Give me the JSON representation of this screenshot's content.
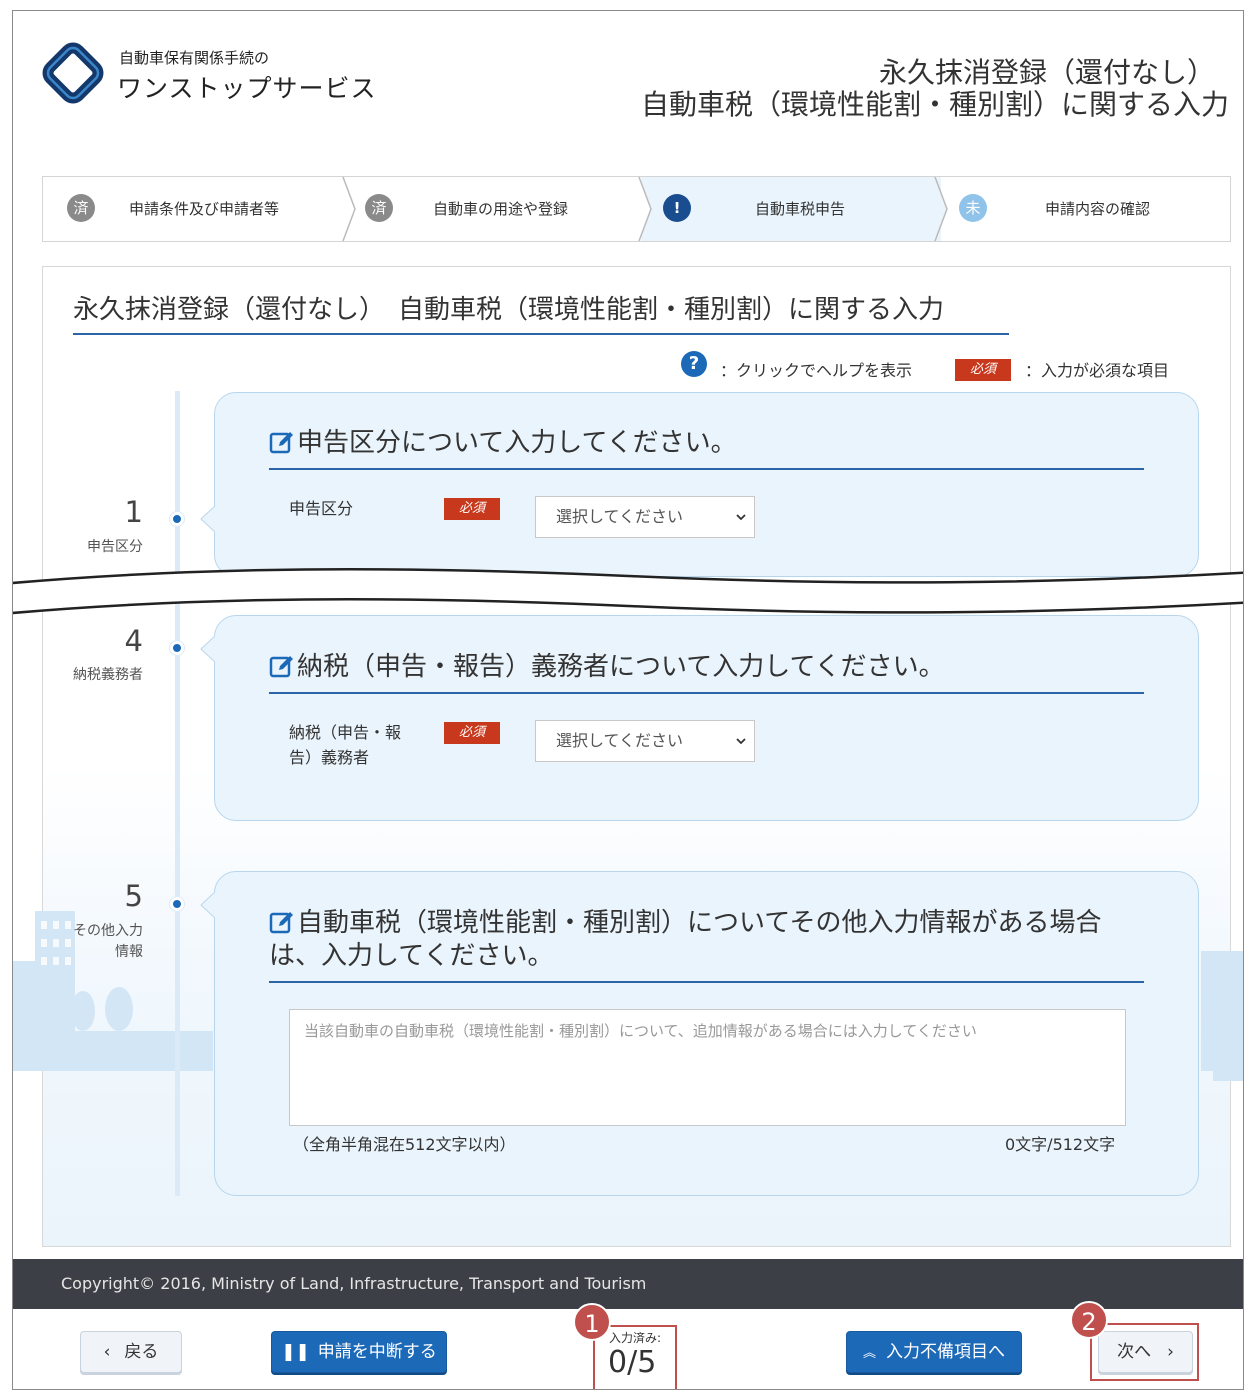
{
  "header": {
    "logo_line1": "自動車保有関係手続の",
    "logo_line2": "ワンストップサービス",
    "title_line1": "永久抹消登録（還付なし）",
    "title_line2": "自動車税（環境性能割・種別割）に関する入力"
  },
  "steps": [
    {
      "badge": "済",
      "label": "申請条件及び申請者等",
      "state": "done",
      "badge_color": "#8a8a8a"
    },
    {
      "badge": "済",
      "label": "自動車の用途や登録",
      "state": "done",
      "badge_color": "#8a8a8a"
    },
    {
      "badge": "!",
      "label": "自動車税申告",
      "state": "current",
      "badge_color": "#1a4d8f"
    },
    {
      "badge": "未",
      "label": "申請内容の確認",
      "state": "todo",
      "badge_color": "#8fc3ea"
    }
  ],
  "main": {
    "title": "永久抹消登録（還付なし）　自動車税（環境性能割・種別割）に関する入力",
    "legend_help_icon": "question-circle-icon",
    "legend_help_text": "：クリックでヘルプを表示",
    "legend_required_badge": "必須",
    "legend_required_text": "：入力が必須な項目"
  },
  "sections": [
    {
      "number": "1",
      "label": "申告区分",
      "title": "申告区分について入力してください。",
      "field_label": "申告区分",
      "required": "必須",
      "select_value": "選択してください"
    },
    {
      "number": "4",
      "label": "納税義務者",
      "title": "納税（申告・報告）義務者について入力してください。",
      "field_label": "納税（申告・報告）義務者",
      "required": "必須",
      "select_value": "選択してください"
    },
    {
      "number": "5",
      "label": "その他入力情報",
      "title": "自動車税（環境性能割・種別割）についてその他入力情報がある場合は、入力してください。",
      "textarea_placeholder": "当該自動車の自動車税（環境性能割・種別割）について、追加情報がある場合には入力してください",
      "textarea_note": "（全角半角混在512文字以内）",
      "textarea_count": "0文字/512文字"
    }
  ],
  "footer": {
    "copyright": "Copyright© 2016, Ministry of Land, Infrastructure, Transport and Tourism",
    "back_label": "戻る",
    "suspend_label": "申請を中断する",
    "progress_label": "入力済み:",
    "progress_value": "0/5",
    "missing_label": "入力不備項目へ",
    "next_label": "次へ"
  },
  "callouts": {
    "one": "1",
    "two": "2"
  },
  "colors": {
    "accent": "#1c69b8",
    "required": "#c7381c",
    "callout": "#c0504d",
    "footer_bg": "#3c3f45"
  }
}
